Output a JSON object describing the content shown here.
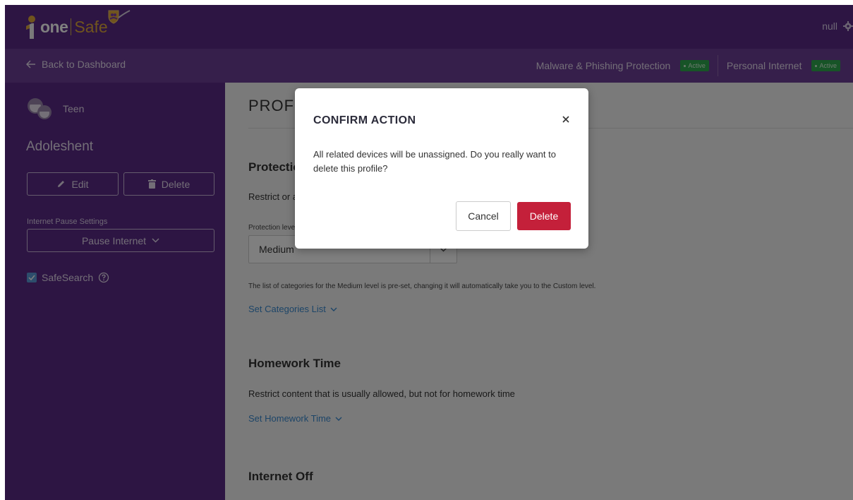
{
  "brand": {
    "name_part1": "one",
    "name_part2": "Safe",
    "accent_color": "#5b2a86",
    "logo_accent": "#e0a83a"
  },
  "header": {
    "user_name": "null",
    "settings_icon": "gear-icon"
  },
  "nav": {
    "back_label": "Back to Dashboard",
    "services": [
      {
        "name": "Malware & Phishing Protection",
        "status": "Active",
        "status_color": "#2fa84f"
      },
      {
        "name": "Personal Internet",
        "status": "Active",
        "status_color": "#2fa84f"
      }
    ]
  },
  "sidebar": {
    "profile_type": "Teen",
    "profile_name": "Adoleshent",
    "edit_label": "Edit",
    "delete_label": "Delete",
    "pause_settings_label": "Internet Pause Settings",
    "pause_select_value": "Pause Internet",
    "safesearch_label": "SafeSearch",
    "safesearch_checked": true
  },
  "main": {
    "page_title": "PROFILE",
    "protection": {
      "title": "Protection",
      "description": "Restrict or allow internet content categories for all devices in this profile.",
      "level_label": "Protection level",
      "level_value": "Medium",
      "note": "The list of categories for the Medium level is pre-set, changing it will automatically take you to the Custom level.",
      "link": "Set Categories List"
    },
    "homework": {
      "title": "Homework Time",
      "description": "Restrict content that is usually allowed, but not for homework time",
      "link": "Set Homework Time"
    },
    "internet_off": {
      "title": "Internet Off"
    }
  },
  "modal": {
    "title": "CONFIRM ACTION",
    "body": "All related devices will be unassigned. Do you really want to delete this profile?",
    "cancel_label": "Cancel",
    "delete_label": "Delete",
    "delete_color": "#c4203a"
  }
}
